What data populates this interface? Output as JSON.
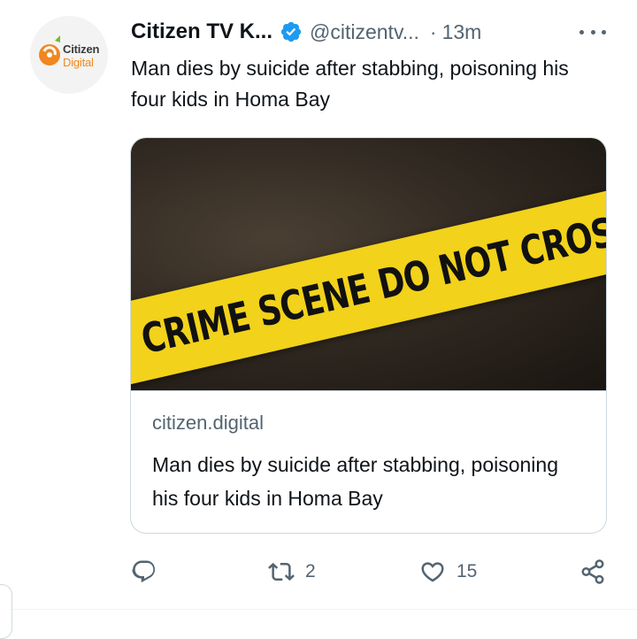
{
  "author": {
    "name": "Citizen TV K...",
    "handle": "@citizentv...",
    "separator": "·",
    "time": "13m",
    "avatar_text_line1": "Citizen",
    "avatar_text_line2": "Digital"
  },
  "tweet": {
    "text": "Man dies by suicide after stabbing, poisoning his four kids in Homa Bay"
  },
  "card": {
    "image_text": "CRIME SCENE DO NOT CROSS",
    "domain": "citizen.digital",
    "title": "Man dies by suicide after stabbing, poisoning his four kids in Homa Bay"
  },
  "actions": {
    "reply_icon": "reply-icon",
    "retweet_icon": "retweet-icon",
    "retweet_count": "2",
    "like_icon": "heart-icon",
    "like_count": "15",
    "share_icon": "share-icon"
  },
  "colors": {
    "verified": "#1d9bf0",
    "muted": "#536471",
    "text": "#0f1419",
    "border": "#cfd9de",
    "brand_orange": "#f0871f",
    "brand_green": "#7ab929"
  }
}
